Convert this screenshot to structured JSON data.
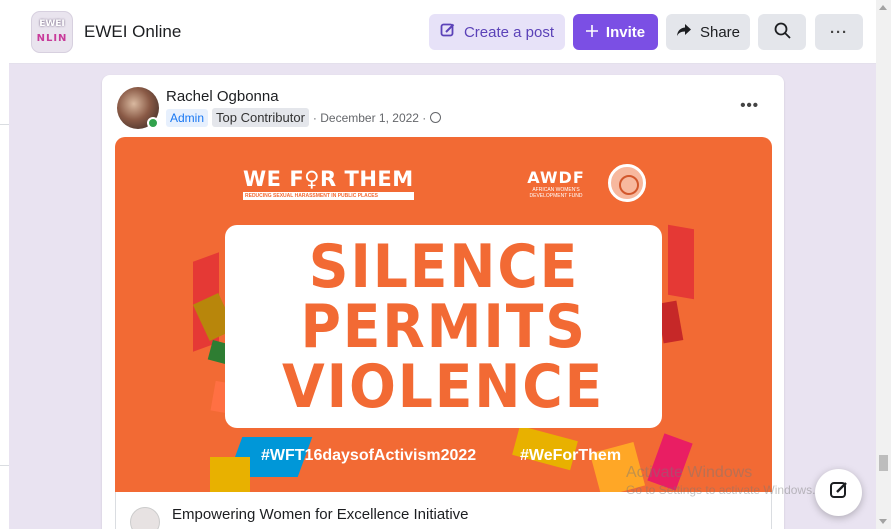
{
  "header": {
    "group_logo_line1": "EWEI",
    "group_logo_line2": "NLIN",
    "group_name": "EWEI Online",
    "create_post_label": "Create a post",
    "invite_label": "Invite",
    "share_label": "Share",
    "more_label": "···"
  },
  "post": {
    "author": "Rachel Ogbonna",
    "badge_admin": "Admin",
    "badge_top": "Top Contributor",
    "date": "· December 1, 2022 ·",
    "more_label": "•••",
    "banner": {
      "logo_title": "WE F♀R THEM",
      "logo_subtitle": "REDUCING SEXUAL HARASSMENT IN PUBLIC PLACES",
      "partner_title": "AWDF",
      "partner_subtitle": "AFRICAN WOMEN'S DEVELOPMENT FUND",
      "slogan_line1": "SILENCE",
      "slogan_line2": "PERMITS",
      "slogan_line3": "VIOLENCE",
      "hashtag_left": "#WFT16daysofActivism2022",
      "hashtag_right": "#WeForThem",
      "colors": {
        "background": "#f26a34",
        "slogan_text": "#f26a34"
      }
    },
    "shared_group_name": "Empowering Women for Excellence Initiative"
  },
  "system_overlay": {
    "watermark_line1": "Activate Windows",
    "watermark_line2": "Go to Settings to activate Windows."
  },
  "colors": {
    "accent": "#7b4fe4",
    "create_button_bg": "#e7e2f8",
    "page_bg": "#e9e3f1"
  }
}
